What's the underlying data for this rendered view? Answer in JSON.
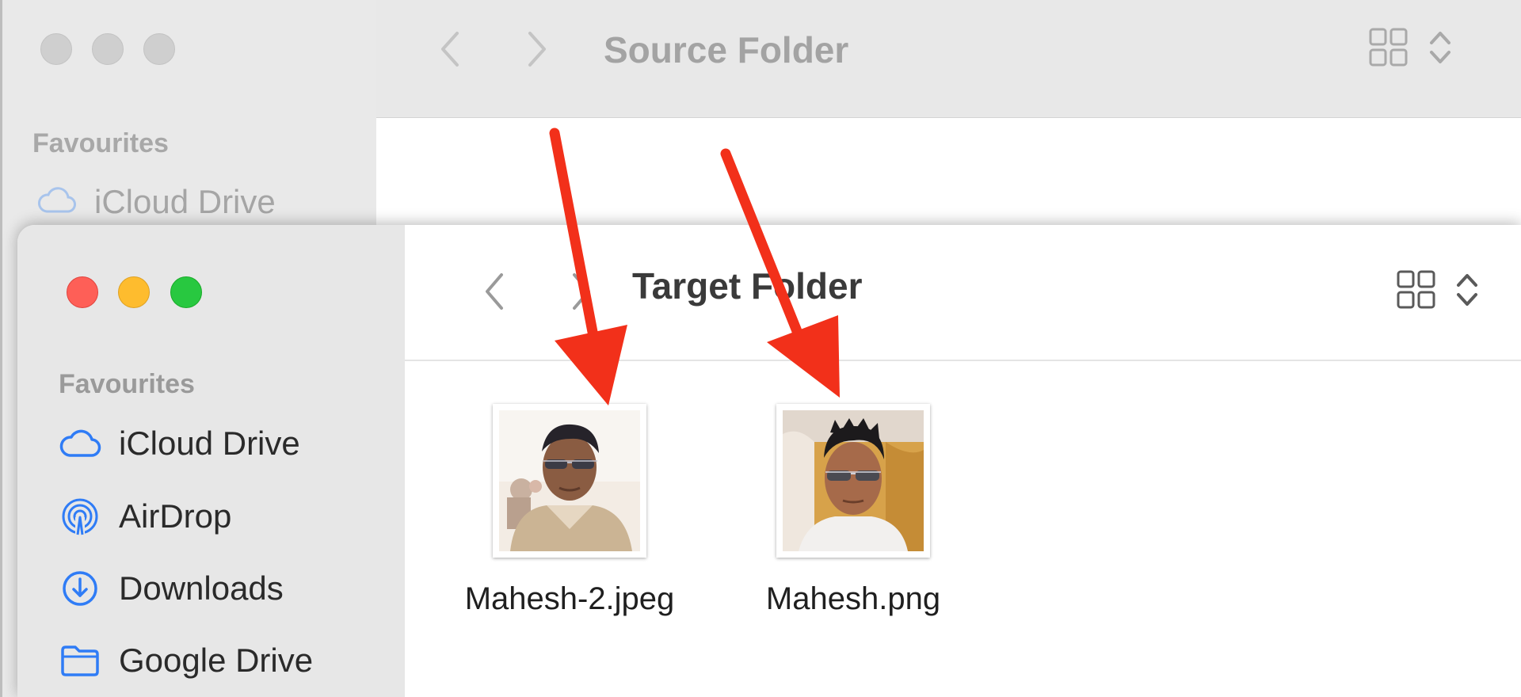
{
  "source_window": {
    "title": "Source Folder",
    "sidebar": {
      "section_label": "Favourites",
      "items": [
        {
          "label": "iCloud Drive",
          "icon": "icloud-icon"
        }
      ]
    }
  },
  "target_window": {
    "title": "Target Folder",
    "sidebar": {
      "section_label": "Favourites",
      "items": [
        {
          "label": "iCloud Drive",
          "icon": "icloud-icon"
        },
        {
          "label": "AirDrop",
          "icon": "airdrop-icon"
        },
        {
          "label": "Downloads",
          "icon": "downloads-icon"
        },
        {
          "label": "Google Drive",
          "icon": "folder-icon"
        }
      ]
    },
    "files": [
      {
        "name": "Mahesh-2.jpeg",
        "icon": "image-thumbnail"
      },
      {
        "name": "Mahesh.png",
        "icon": "image-thumbnail"
      }
    ]
  },
  "colors": {
    "close": "#fe5f57",
    "minimize": "#febc2e",
    "zoom": "#28c840",
    "accent": "#2f7cf6",
    "annotation_arrow": "#f2301a"
  }
}
